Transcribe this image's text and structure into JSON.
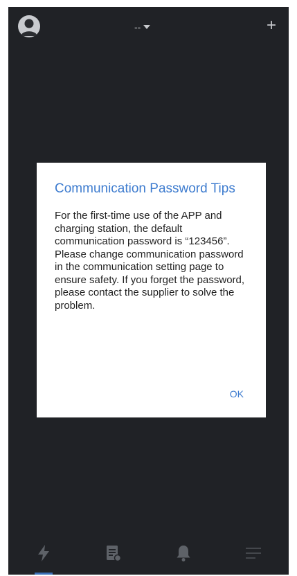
{
  "header": {
    "station_label": "--",
    "add_label": "+"
  },
  "dialog": {
    "title": "Communication Password Tips",
    "body": "For the first-time use of the APP and charging station, the default communication password is “123456”. Please change communication password in the communication setting page to ensure safety. If you forget the password, please contact the supplier to solve the problem.",
    "ok_label": "OK"
  },
  "bottom_nav": {
    "items": [
      {
        "icon": "lightning-icon",
        "active": true
      },
      {
        "icon": "document-icon",
        "active": false
      },
      {
        "icon": "bell-icon",
        "active": false
      },
      {
        "icon": "menu-icon",
        "active": false
      }
    ]
  },
  "colors": {
    "background": "#202226",
    "accent": "#3e7ccf",
    "icon_muted": "#5e6268"
  }
}
